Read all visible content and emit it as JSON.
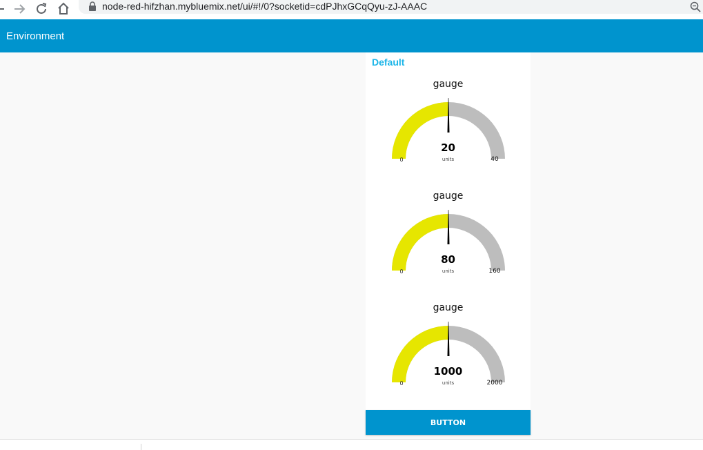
{
  "browser": {
    "url": "node-red-hifzhan.mybluemix.net/ui/#!/0?socketid=cdPJhxGCqQyu-zJ-AAAC",
    "icons": [
      "back-icon",
      "forward-icon",
      "reload-icon",
      "home-icon",
      "lock-icon",
      "zoom-icon"
    ]
  },
  "toolbar": {
    "title": "Environment"
  },
  "group": {
    "title": "Default"
  },
  "gauges": [
    {
      "title": "gauge",
      "value": "20",
      "units": "units",
      "min": "0",
      "max": "40",
      "level": 0.5
    },
    {
      "title": "gauge",
      "value": "80",
      "units": "units",
      "min": "0",
      "max": "160",
      "level": 0.5
    },
    {
      "title": "gauge",
      "value": "1000",
      "units": "units",
      "min": "0",
      "max": "2000",
      "level": 0.5
    }
  ],
  "button": {
    "label": "BUTTON"
  },
  "colors": {
    "toolbar": "#0094ce",
    "group_title": "#1bb5e8",
    "gauge_fill": "#e6e600",
    "gauge_track": "#bdbdbd",
    "needle": "#000000",
    "button": "#0094ce"
  }
}
